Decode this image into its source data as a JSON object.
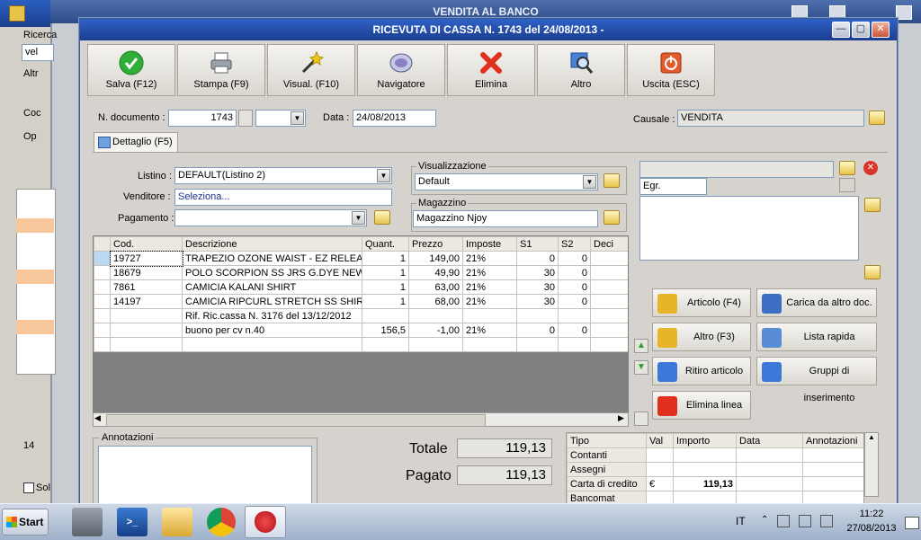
{
  "background": {
    "title": "VENDITA AL BANCO",
    "left_labels": [
      "Ricerca",
      "vel",
      "Altr",
      "Op",
      "Coc",
      "14",
      "Sol"
    ]
  },
  "window": {
    "title": "RICEVUTA DI CASSA N. 1743 del 24/08/2013 -",
    "controls": {
      "minimize": "—",
      "maximize": "▢",
      "close": "✕"
    }
  },
  "toolbar": [
    {
      "label": "Salva (F12)",
      "icon": "check-icon"
    },
    {
      "label": "Stampa (F9)",
      "icon": "printer-icon"
    },
    {
      "label": "Visual. (F10)",
      "icon": "magic-wand-icon"
    },
    {
      "label": "Navigatore",
      "icon": "compass-icon"
    },
    {
      "label": "Elimina",
      "icon": "delete-x-icon"
    },
    {
      "label": "Altro",
      "icon": "magnifier-icon"
    },
    {
      "label": "Uscita (ESC)",
      "icon": "exit-icon"
    }
  ],
  "header": {
    "doc_label": "N. documento :",
    "doc_value": "1743",
    "date_label": "Data :",
    "date_value": "24/08/2013",
    "causale_label": "Causale :",
    "causale_value": "VENDITA"
  },
  "tab": {
    "label": "Dettaglio (F5)"
  },
  "form": {
    "listino_label": "Listino :",
    "listino_value": "DEFAULT(Listino 2)",
    "venditore_label": "Venditore :",
    "venditore_value": "Seleziona...",
    "pagamento_label": "Pagamento :",
    "pagamento_value": "",
    "visual_label": "Visualizzazione",
    "visual_value": "Default",
    "magazzino_label": "Magazzino",
    "magazzino_value": "Magazzino Njoy",
    "customer_value": "Egr."
  },
  "grid": {
    "columns": [
      "Cod.",
      "Descrizione",
      "Quant.",
      "Prezzo",
      "Imposte",
      "S1",
      "S2",
      "Deci"
    ],
    "rows": [
      [
        "19727",
        "TRAPEZIO OZONE WAIST - EZ RELEASE",
        "1",
        "149,00",
        "21%",
        "0",
        "0",
        ""
      ],
      [
        "18679",
        "POLO SCORPION SS JRS G.DYE NEW...",
        "1",
        "49,90",
        "21%",
        "30",
        "0",
        ""
      ],
      [
        "7861",
        "CAMICIA KALANI SHIRT",
        "1",
        "63,00",
        "21%",
        "30",
        "0",
        ""
      ],
      [
        "14197",
        "CAMICIA RIPCURL STRETCH SS SHIRT",
        "1",
        "68,00",
        "21%",
        "30",
        "0",
        ""
      ],
      [
        "",
        "Rif. Ric.cassa N. 3176 del 13/12/2012",
        "",
        "",
        "",
        "",
        "",
        ""
      ],
      [
        "",
        "buono per cv n.40",
        "156,5",
        "-1,00",
        "21%",
        "0",
        "0",
        ""
      ],
      [
        "",
        "",
        "",
        "",
        "",
        "",
        "",
        ""
      ]
    ]
  },
  "side_buttons": [
    {
      "label": "Articolo (F4)",
      "icon": "cube-add-icon"
    },
    {
      "label": "Carica da altro doc.",
      "icon": "checklist-icon"
    },
    {
      "label": "Altro (F3)",
      "icon": "grid-add-icon"
    },
    {
      "label": "Lista rapida",
      "icon": "hand-list-icon"
    },
    {
      "label": "Ritiro articolo",
      "icon": "undo-arrow-icon"
    },
    {
      "label": "Gruppi di inserimento",
      "icon": "group-add-icon"
    },
    {
      "label": "Elimina linea",
      "icon": "delete-x-icon"
    }
  ],
  "annotazioni_label": "Annotazioni",
  "totals": {
    "totale_label": "Totale",
    "totale_value": "119,13",
    "pagato_label": "Pagato",
    "pagato_value": "119,13"
  },
  "payments": {
    "columns": [
      "Tipo",
      "Val",
      "Importo",
      "Data",
      "Annotazioni"
    ],
    "rows": [
      [
        "Contanti",
        "",
        "",
        "",
        ""
      ],
      [
        "Assegni",
        "",
        "",
        "",
        ""
      ],
      [
        "Carta di credito",
        "€",
        "119,13",
        "",
        ""
      ],
      [
        "Bancomat",
        "",
        "",
        "",
        ""
      ]
    ]
  },
  "taskbar": {
    "start_label": "Start",
    "lang": "IT",
    "time": "11:22",
    "date": "27/08/2013"
  }
}
